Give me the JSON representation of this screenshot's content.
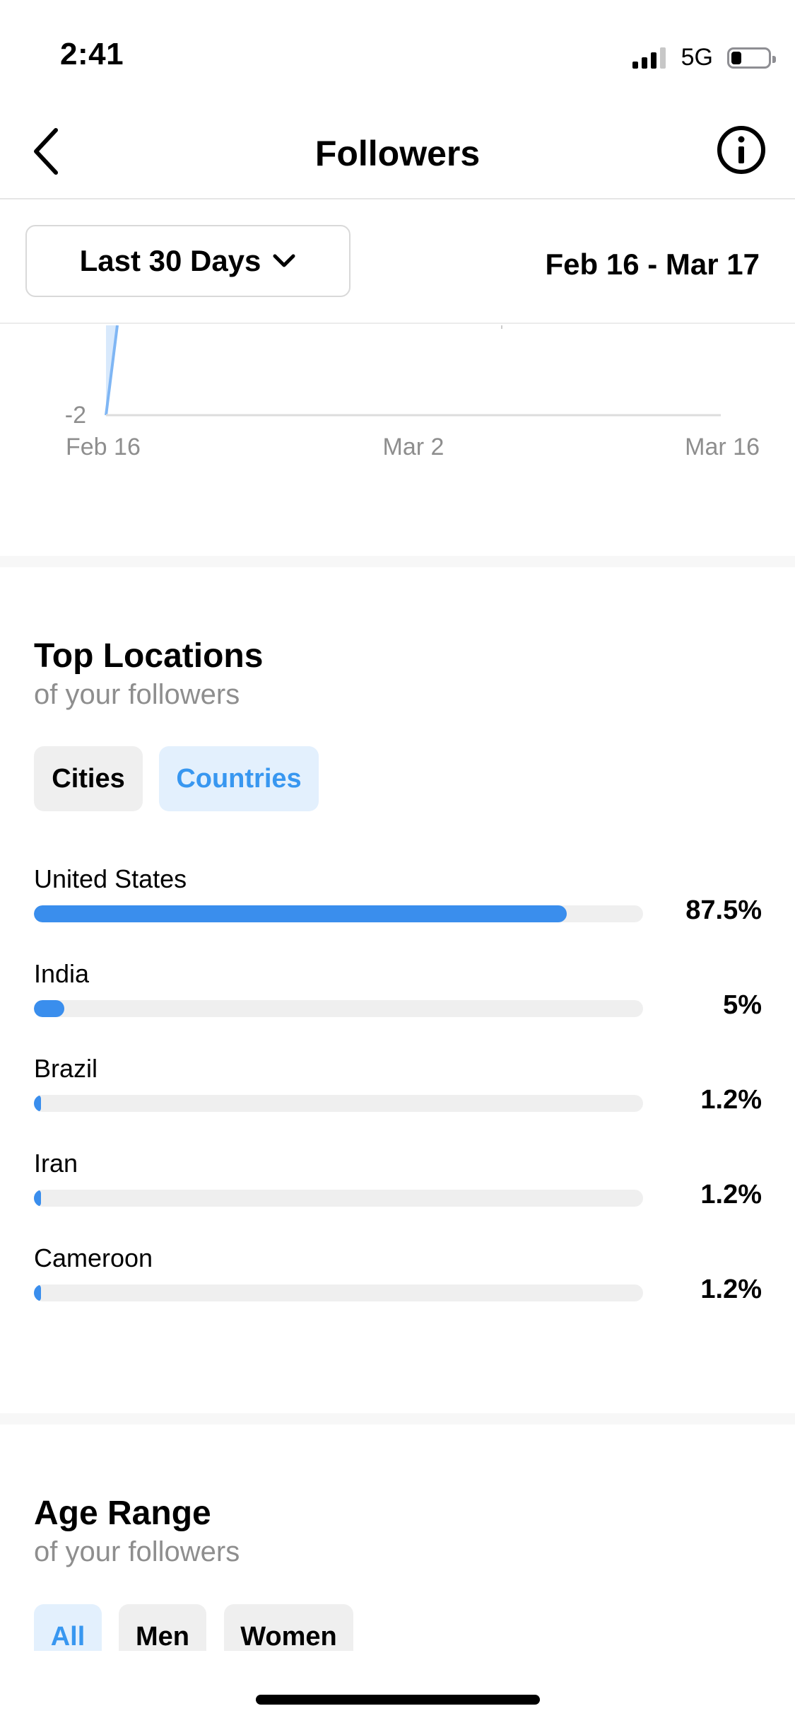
{
  "status_bar": {
    "time": "2:41",
    "network": "5G",
    "signal_bars_filled": 3,
    "battery_level": 0.2
  },
  "header": {
    "title": "Followers",
    "back_icon": "chevron-left-icon",
    "info_icon": "info-circle-icon"
  },
  "filter": {
    "range_label": "Last 30 Days",
    "dropdown_icon": "chevron-down-icon",
    "date_range": "Feb 16 - Mar 17"
  },
  "chart_data": {
    "type": "area",
    "title": "",
    "xlabel": "",
    "ylabel": "",
    "y_tick_labels": [
      "-2"
    ],
    "x_tick_labels": [
      "Feb 16",
      "Mar 2",
      "Mar 16"
    ],
    "color": "#7fb6f4",
    "grid": false
  },
  "top_locations": {
    "title": "Top Locations",
    "subtitle": "of your followers",
    "tabs": [
      {
        "label": "Cities",
        "active": false
      },
      {
        "label": "Countries",
        "active": true
      }
    ],
    "items": [
      {
        "name": "United States",
        "value_label": "87.5%",
        "fraction": 0.875
      },
      {
        "name": "India",
        "value_label": "5%",
        "fraction": 0.05
      },
      {
        "name": "Brazil",
        "value_label": "1.2%",
        "fraction": 0.012
      },
      {
        "name": "Iran",
        "value_label": "1.2%",
        "fraction": 0.012
      },
      {
        "name": "Cameroon",
        "value_label": "1.2%",
        "fraction": 0.012
      }
    ]
  },
  "age_range": {
    "title": "Age Range",
    "subtitle": "of your followers",
    "tabs": [
      {
        "label": "All",
        "active": true
      },
      {
        "label": "Men",
        "active": false
      },
      {
        "label": "Women",
        "active": false
      }
    ]
  },
  "colors": {
    "accent": "#3897f0",
    "bar": "#3a8eed",
    "track": "#efefef"
  }
}
